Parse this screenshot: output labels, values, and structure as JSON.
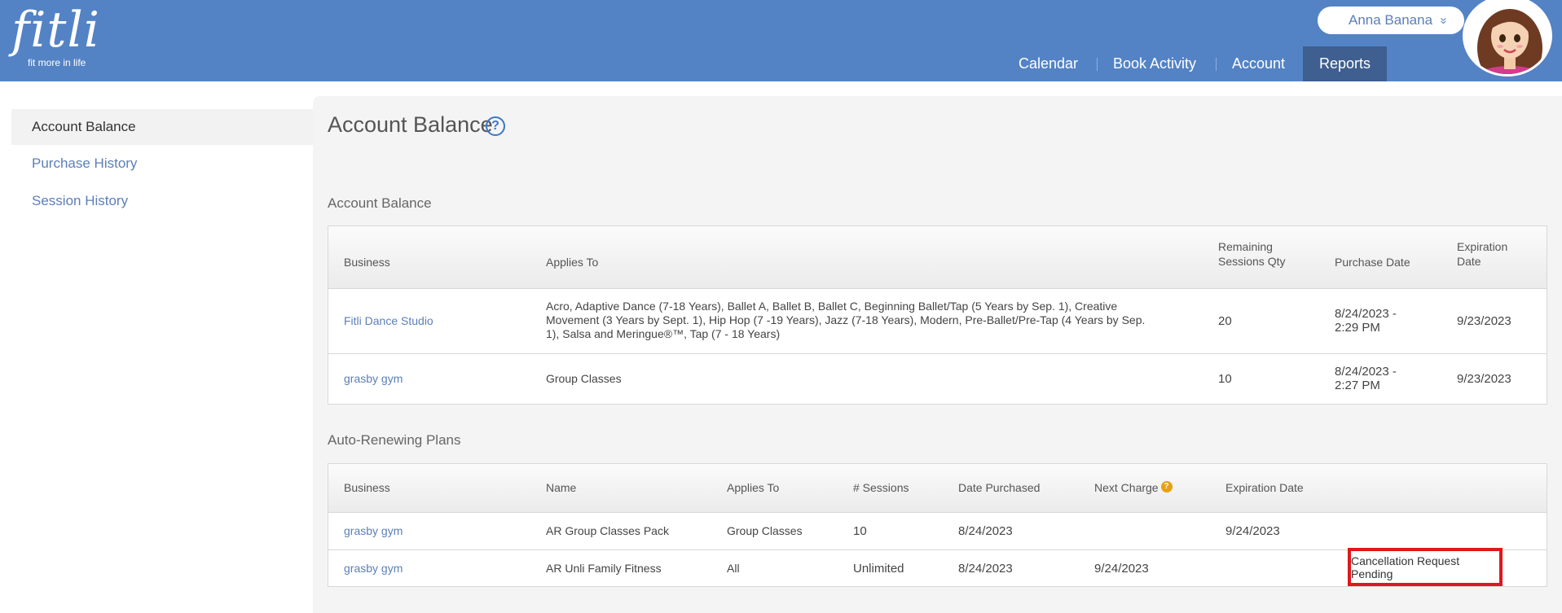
{
  "app": {
    "logo_text": "fitli",
    "logo_tagline": "fit more in life"
  },
  "user": {
    "name": "Anna Banana",
    "menu_chevron": "»"
  },
  "nav": {
    "items": [
      {
        "label": "Calendar"
      },
      {
        "label": "Book Activity"
      },
      {
        "label": "Account"
      },
      {
        "label": "Reports"
      }
    ]
  },
  "sidebar": {
    "items": [
      {
        "label": "Account Balance"
      },
      {
        "label": "Purchase History"
      },
      {
        "label": "Session History"
      }
    ]
  },
  "page": {
    "title": "Account Balance",
    "help_icon": "?"
  },
  "balance": {
    "section_title": "Account Balance",
    "headers": {
      "business": "Business",
      "applies_to": "Applies To",
      "remaining_1": "Remaining",
      "remaining_2": "Sessions Qty",
      "purchase_date": "Purchase Date",
      "expiration_1": "Expiration",
      "expiration_2": "Date"
    },
    "rows": [
      {
        "business": "Fitli Dance Studio",
        "applies_to_1": "Acro, Adaptive Dance (7-18 Years), Ballet A, Ballet B, Ballet C, Beginning Ballet/Tap (5 Years by Sep. 1), Creative",
        "applies_to_2": "Movement (3 Years by Sept. 1), Hip Hop (7 -19 Years), Jazz (7-18 Years), Modern, Pre-Ballet/Pre-Tap (4 Years by Sep.",
        "applies_to_3": "1), Salsa and Meringue®™, Tap (7 - 18 Years)",
        "remaining": "20",
        "purchase_1": "8/24/2023 -",
        "purchase_2": "2:29 PM",
        "expiration": "9/23/2023"
      },
      {
        "business": "grasby gym",
        "applies_to_1": "Group Classes",
        "remaining": "10",
        "purchase_1": "8/24/2023 -",
        "purchase_2": "2:27 PM",
        "expiration": "9/23/2023"
      }
    ]
  },
  "plans": {
    "section_title": "Auto-Renewing Plans",
    "headers": {
      "business": "Business",
      "name": "Name",
      "applies_to": "Applies To",
      "sessions": "# Sessions",
      "date_purchased": "Date Purchased",
      "next_charge": "Next Charge",
      "next_charge_help": "?",
      "expiration": "Expiration Date"
    },
    "rows": [
      {
        "business": "grasby gym",
        "name": "AR Group Classes Pack",
        "applies_to": "Group Classes",
        "sessions": "10",
        "date_purchased": "8/24/2023",
        "next_charge": "",
        "expiration": "9/24/2023",
        "status": ""
      },
      {
        "business": "grasby gym",
        "name": "AR Unli Family Fitness",
        "applies_to": "All",
        "sessions": "Unlimited",
        "date_purchased": "8/24/2023",
        "next_charge": "9/24/2023",
        "expiration": "",
        "status": "Cancellation Request Pending"
      }
    ]
  },
  "colors": {
    "header_bg": "#5383c5",
    "nav_active_bg": "#3e5f8f",
    "link": "#5b7fb8",
    "highlight_border": "#e0171c",
    "help_orange": "#e8a10c"
  }
}
